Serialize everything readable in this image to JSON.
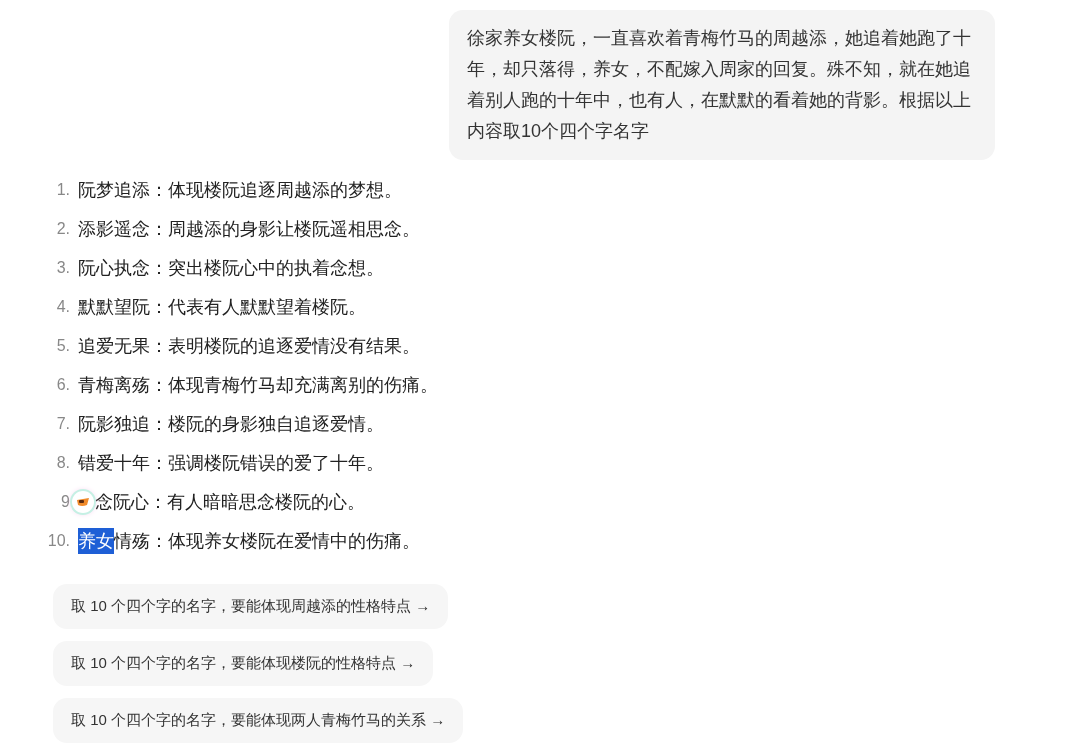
{
  "user_message": "徐家养女楼阮，一直喜欢着青梅竹马的周越添，她追着她跑了十年，却只落得，养女，不配嫁入周家的回复。殊不知，就在她追着别人跑的十年中，也有人，在默默的看着她的背影。根据以上内容取10个四个字名字",
  "answer_items": [
    {
      "kind": "plain",
      "number": "1.",
      "text": "阮梦追添：体现楼阮追逐周越添的梦想。"
    },
    {
      "kind": "plain",
      "number": "2.",
      "text": "添影遥念：周越添的身影让楼阮遥相思念。"
    },
    {
      "kind": "plain",
      "number": "3.",
      "text": "阮心执念：突出楼阮心中的执着念想。"
    },
    {
      "kind": "plain",
      "number": "4.",
      "text": "默默望阮：代表有人默默望着楼阮。"
    },
    {
      "kind": "plain",
      "number": "5.",
      "text": "追爱无果：表明楼阮的追逐爱情没有结果。"
    },
    {
      "kind": "plain",
      "number": "6.",
      "text": "青梅离殇：体现青梅竹马却充满离别的伤痛。"
    },
    {
      "kind": "plain",
      "number": "7.",
      "text": "阮影独追：楼阮的身影独自追逐爱情。"
    },
    {
      "kind": "plain",
      "number": "8.",
      "text": "错爱十年：强调楼阮错误的爱了十年。"
    },
    {
      "kind": "icon",
      "number": "9",
      "text": "念阮心：有人暗暗思念楼阮的心。"
    },
    {
      "kind": "selection",
      "number": "10.",
      "selected_text": "养女",
      "text": "情殇：体现养女楼阮在爱情中的伤痛。"
    }
  ],
  "suggestions": [
    "取 10 个四个字的名字，要能体现周越添的性格特点 →",
    "取 10 个四个字的名字，要能体现楼阮的性格特点 →",
    "取 10 个四个字的名字，要能体现两人青梅竹马的关系 →"
  ]
}
